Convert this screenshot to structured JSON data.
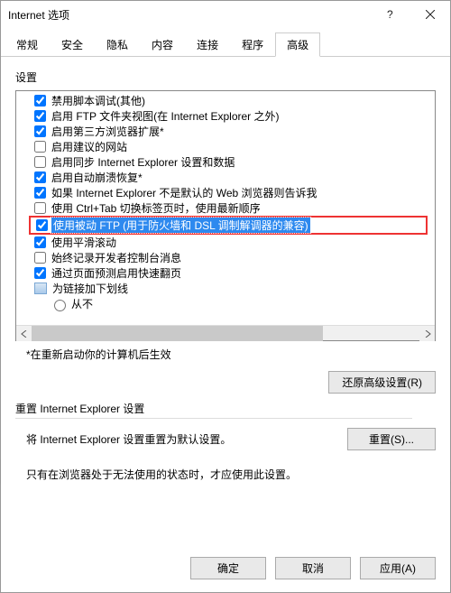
{
  "title": "Internet 选项",
  "tabs": [
    "常规",
    "安全",
    "隐私",
    "内容",
    "连接",
    "程序",
    "高级"
  ],
  "active_tab": 6,
  "settings": {
    "label": "设置",
    "items": [
      {
        "k": "checkbox",
        "c": true,
        "t": "禁用脚本调试(其他)"
      },
      {
        "k": "checkbox",
        "c": true,
        "t": "启用 FTP 文件夹视图(在 Internet Explorer 之外)"
      },
      {
        "k": "checkbox",
        "c": true,
        "t": "启用第三方浏览器扩展*"
      },
      {
        "k": "checkbox",
        "c": false,
        "t": "启用建议的网站"
      },
      {
        "k": "checkbox",
        "c": false,
        "t": "启用同步 Internet Explorer 设置和数据"
      },
      {
        "k": "checkbox",
        "c": true,
        "t": "启用自动崩溃恢复*"
      },
      {
        "k": "checkbox",
        "c": true,
        "t": "如果 Internet Explorer 不是默认的 Web 浏览器则告诉我"
      },
      {
        "k": "checkbox",
        "c": false,
        "t": "使用 Ctrl+Tab 切换标签页时，使用最新顺序"
      },
      {
        "k": "checkbox",
        "c": true,
        "sel": true,
        "t": "使用被动 FTP (用于防火墙和 DSL 调制解调器的兼容)"
      },
      {
        "k": "checkbox",
        "c": true,
        "t": "使用平滑滚动"
      },
      {
        "k": "checkbox",
        "c": false,
        "t": "始终记录开发者控制台消息"
      },
      {
        "k": "checkbox",
        "c": true,
        "t": "通过页面预测启用快速翻页"
      },
      {
        "k": "group",
        "t": "为链接加下划线"
      },
      {
        "k": "radio",
        "c": false,
        "t": "从不"
      }
    ],
    "restart_note": "*在重新启动你的计算机后生效",
    "restore_btn": "还原高级设置(R)"
  },
  "reset": {
    "title": "重置 Internet Explorer 设置",
    "desc": "将 Internet Explorer 设置重置为默认设置。",
    "btn": "重置(S)...",
    "note": "只有在浏览器处于无法使用的状态时，才应使用此设置。"
  },
  "footer": {
    "ok": "确定",
    "cancel": "取消",
    "apply": "应用(A)"
  }
}
